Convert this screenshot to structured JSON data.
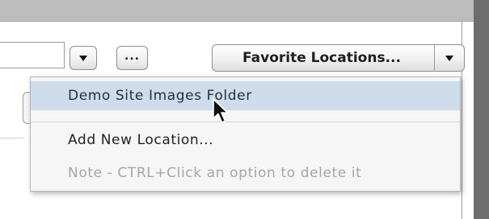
{
  "toolbar": {
    "ellipsis_label": "...",
    "favorites_label": "Favorite Locations..."
  },
  "menu": {
    "items": [
      {
        "label": "Demo Site Images Folder",
        "state": "highlighted"
      },
      {
        "label": "Add New Location...",
        "state": "enabled"
      },
      {
        "label": "Note - CTRL+Click an option to delete it",
        "state": "disabled"
      }
    ]
  },
  "colors": {
    "highlight": "#cfdcec",
    "menu_background": "#f6f6f6",
    "disabled_text": "#a6a6a6",
    "titlebar": "#bdbdbd"
  },
  "icons": {
    "dropdown": "triangle-down-icon",
    "cursor": "arrow-cursor-icon"
  }
}
